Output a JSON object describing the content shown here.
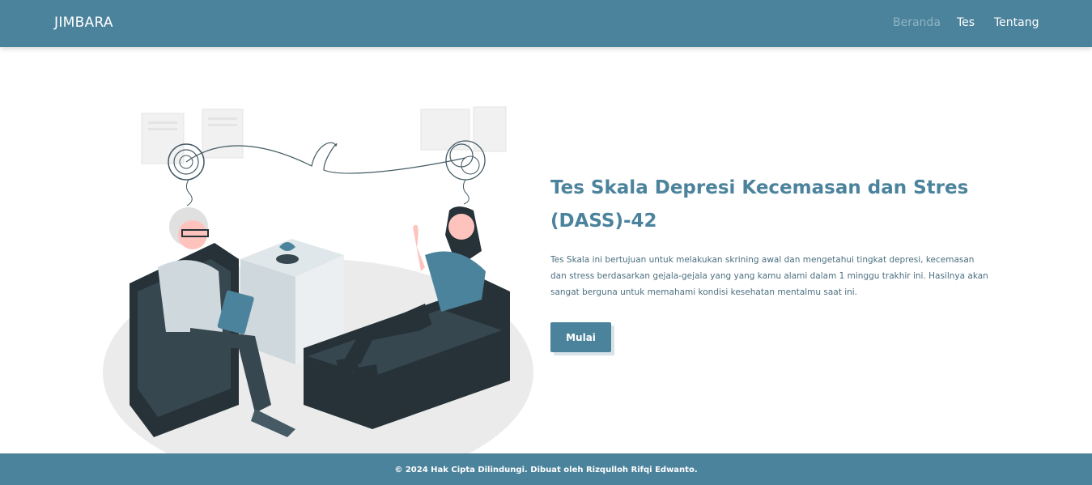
{
  "navbar": {
    "brand": "JIMBARA",
    "links": [
      {
        "label": "Beranda",
        "active": true
      },
      {
        "label": "Tes",
        "active": false
      },
      {
        "label": "Tentang",
        "active": false
      }
    ]
  },
  "hero": {
    "title": "Tes Skala Depresi Kecemasan dan Stres (DASS)-42",
    "description": "Tes Skala ini bertujuan untuk melakukan skrining awal dan mengetahui tingkat depresi, kecemasan dan stress berdasarkan gejala-gejala yang yang kamu alami dalam 1 minggu trakhir ini. Hasilnya akan sangat berguna untuk memahami kondisi kesehatan mentalmu saat ini.",
    "button_label": "Mulai"
  },
  "footer": {
    "text": "© 2024 Hak Cipta Dilindungi. Dibuat oleh Rizqulloh Rifqi Edwanto."
  },
  "colors": {
    "primary": "#4c839c",
    "nav_active": "#8fb4c3",
    "dark_teal": "#263238",
    "sofa": "#37474f"
  }
}
